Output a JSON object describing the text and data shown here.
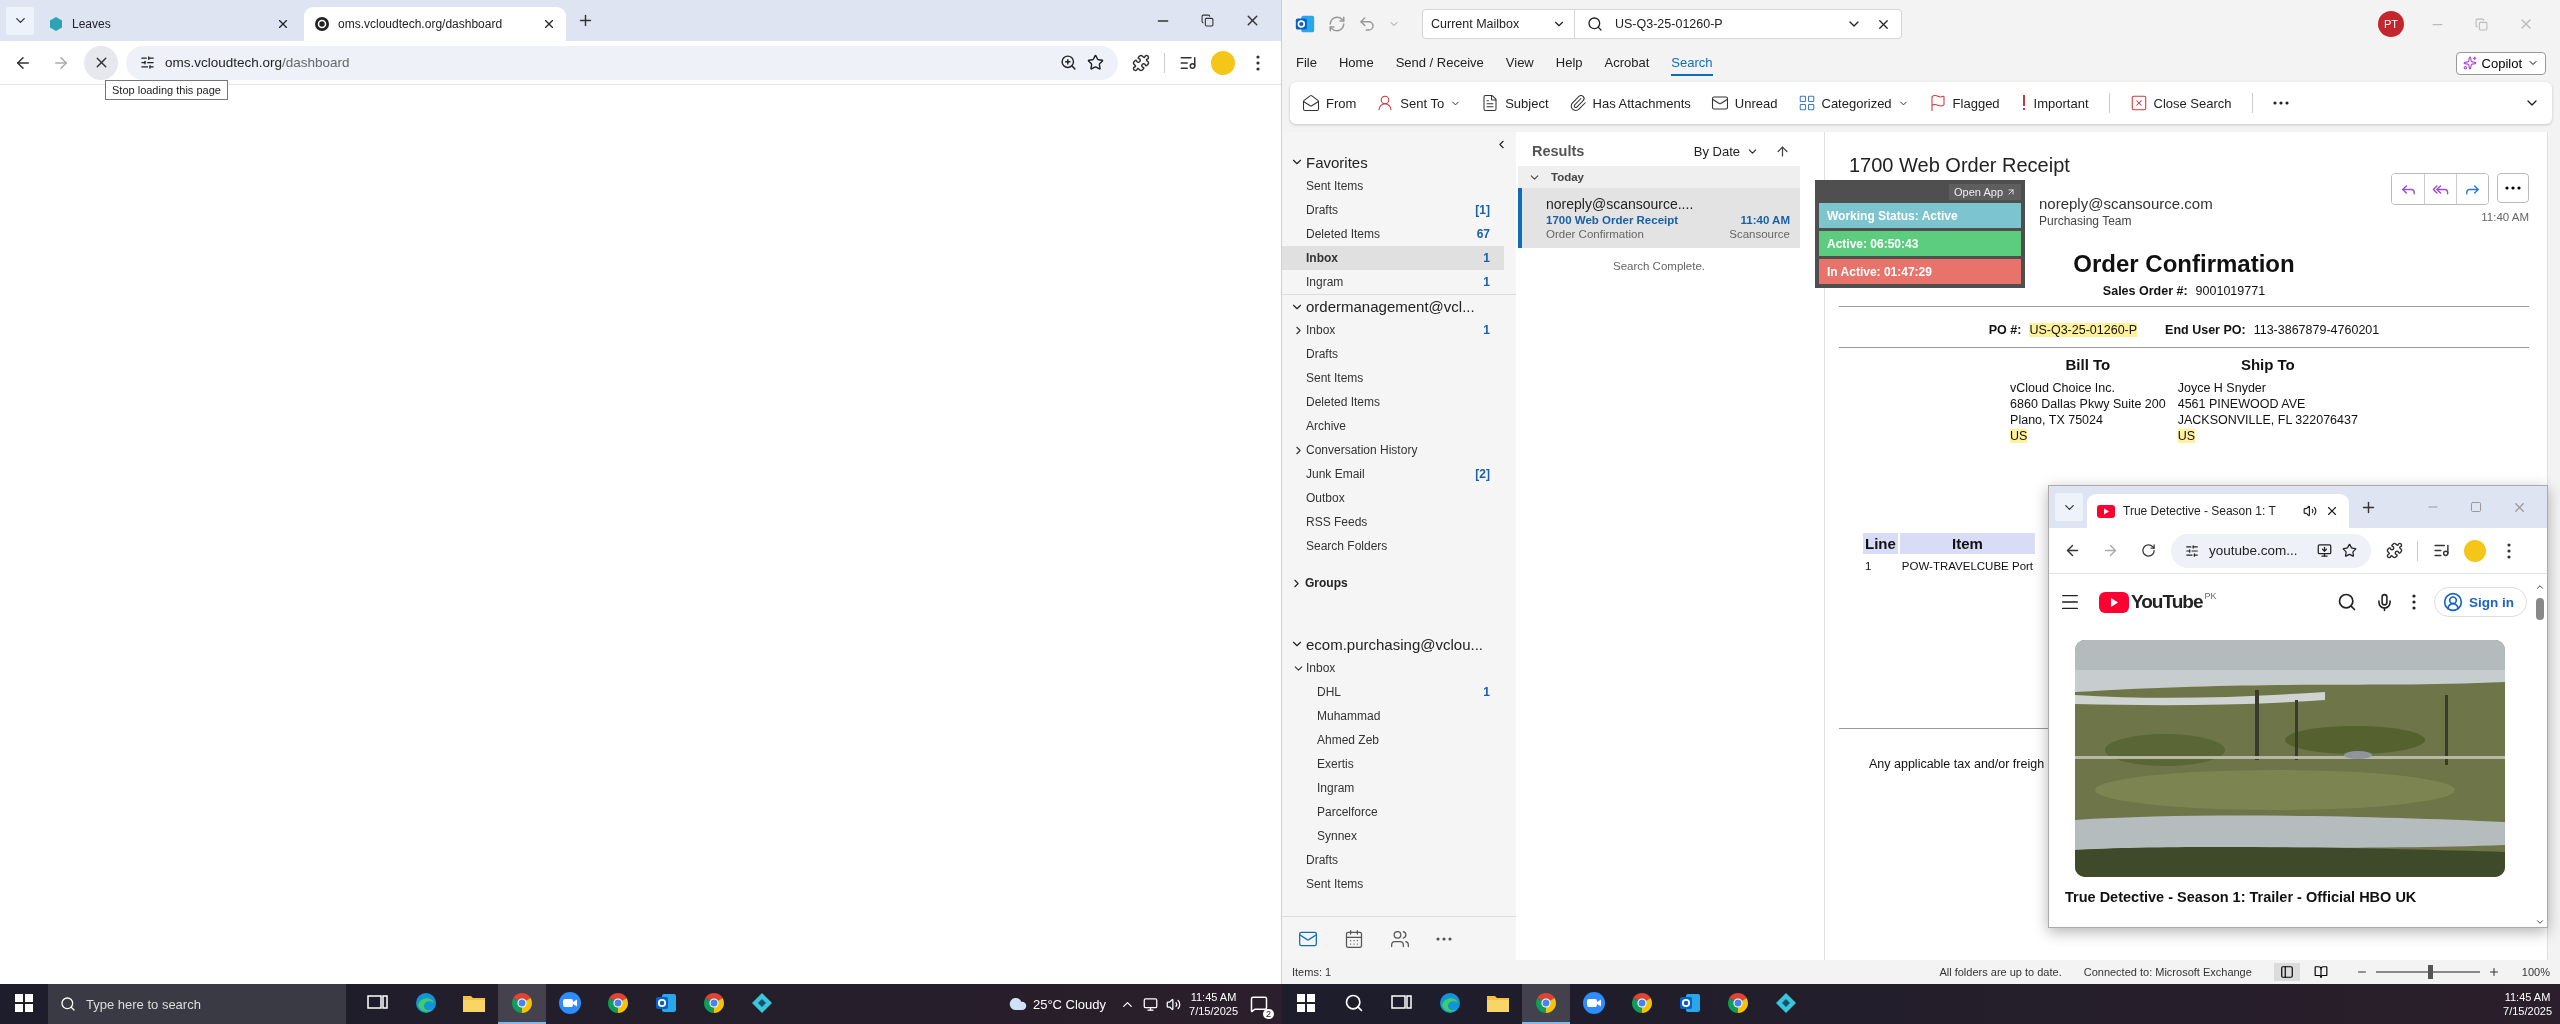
{
  "left_browser": {
    "tabs": [
      {
        "title": "Leaves",
        "selected": false
      },
      {
        "title": "oms.vcloudtech.org/dashboard",
        "selected": true
      }
    ],
    "loading": true,
    "address": {
      "host": "oms.vcloudtech.org",
      "path": "/dashboard"
    },
    "tooltip": "Stop loading this page"
  },
  "outlook": {
    "search": {
      "scope": "Current Mailbox",
      "query": "US-Q3-25-01260-P"
    },
    "account_initials": "PT",
    "menu": [
      {
        "label": "File",
        "selected": false
      },
      {
        "label": "Home",
        "selected": false
      },
      {
        "label": "Send / Receive",
        "selected": false
      },
      {
        "label": "View",
        "selected": false
      },
      {
        "label": "Help",
        "selected": false
      },
      {
        "label": "Acrobat",
        "selected": false
      },
      {
        "label": "Search",
        "selected": true
      }
    ],
    "copilot": "Copilot",
    "ribbon": [
      {
        "kind": "from",
        "label": "From",
        "dropdown": false
      },
      {
        "kind": "sent-to",
        "label": "Sent To",
        "dropdown": true
      },
      {
        "kind": "subject",
        "label": "Subject",
        "dropdown": false
      },
      {
        "kind": "attachments",
        "label": "Has Attachments",
        "dropdown": false
      },
      {
        "kind": "unread",
        "label": "Unread",
        "dropdown": false
      },
      {
        "kind": "categorized",
        "label": "Categorized",
        "dropdown": true
      },
      {
        "kind": "flagged",
        "label": "Flagged",
        "dropdown": false
      },
      {
        "kind": "important",
        "label": "Important",
        "dropdown": false
      },
      {
        "kind": "close",
        "label": "Close Search",
        "dropdown": false
      }
    ],
    "folder_groups": [
      {
        "kind": "heading",
        "title": "Favorites",
        "expanded": true,
        "folders": [
          {
            "name": "Sent Items",
            "selected": false
          },
          {
            "name": "Drafts",
            "count": "[1]",
            "selected": false
          },
          {
            "name": "Deleted Items",
            "count": "67",
            "selected": false
          },
          {
            "name": "Inbox",
            "count": "1",
            "selected": true
          },
          {
            "name": "Ingram",
            "count": "1",
            "selected": false
          }
        ]
      },
      {
        "kind": "heading",
        "title": "ordermanagement@vcl...",
        "expanded": true,
        "folders": [
          {
            "name": "Inbox",
            "count": "1",
            "expanded": false,
            "selected": false
          },
          {
            "name": "Drafts",
            "selected": false
          },
          {
            "name": "Sent Items",
            "selected": false
          },
          {
            "name": "Deleted Items",
            "selected": false
          },
          {
            "name": "Archive",
            "selected": false
          },
          {
            "name": "Conversation History",
            "expanded": false,
            "selected": false
          },
          {
            "name": "Junk Email",
            "count": "[2]",
            "selected": false
          },
          {
            "name": "Outbox",
            "selected": false
          },
          {
            "name": "RSS Feeds",
            "selected": false
          },
          {
            "name": "Search Folders",
            "selected": false
          }
        ]
      },
      {
        "kind": "section",
        "title": "Groups",
        "expanded": false
      },
      {
        "kind": "heading",
        "title": "ecom.purchasing@vclou...",
        "expanded": true,
        "folders": [
          {
            "name": "Inbox",
            "expanded": true,
            "selected": false,
            "children": [
              {
                "name": "DHL",
                "count": "1",
                "selected": false
              },
              {
                "name": "Muhammad",
                "selected": false
              },
              {
                "name": "Ahmed Zeb",
                "selected": false
              },
              {
                "name": "Exertis",
                "selected": false
              },
              {
                "name": "Ingram",
                "selected": false
              },
              {
                "name": "Parcelforce",
                "selected": false
              },
              {
                "name": "Synnex",
                "selected": false
              }
            ]
          },
          {
            "name": "Drafts",
            "selected": false
          },
          {
            "name": "Sent Items",
            "selected": false
          }
        ]
      }
    ],
    "nav": [
      {
        "kind": "mail",
        "selected": true
      },
      {
        "kind": "calendar",
        "selected": false
      },
      {
        "kind": "people",
        "selected": false
      },
      {
        "kind": "more",
        "selected": false
      }
    ],
    "results": {
      "title": "Results",
      "sort": "By Date",
      "group": "Today",
      "messages": [
        {
          "sender": "noreply@scansource....",
          "subject": "1700 Web Order Receipt",
          "time": "11:40 AM",
          "preview": "Order Confirmation",
          "tag": "Scansource",
          "selected": true
        }
      ],
      "status": "Search Complete."
    },
    "reading": {
      "subject": "1700 Web Order Receipt",
      "sender": "noreply@scansource.com",
      "to": "Purchasing Team",
      "time": "11:40 AM",
      "body": {
        "title": "Order Confirmation",
        "sales_order_label": "Sales Order #:",
        "sales_order": "9001019771",
        "order_fields": [
          {
            "label": "PO #:",
            "value": "US-Q3-25-01260-P",
            "highlighted": true
          },
          {
            "label": "End User PO:",
            "value": "113-3867879-4760201",
            "highlighted": false
          }
        ],
        "addresses": [
          {
            "title": "Bill To",
            "lines": [
              {
                "text": "vCloud Choice Inc.",
                "highlighted": false
              },
              {
                "text": "6860 Dallas Pkwy Suite 200",
                "highlighted": false
              },
              {
                "text": "Plano, TX 75024",
                "highlighted": false
              },
              {
                "text": "US",
                "highlighted": true
              }
            ]
          },
          {
            "title": "Ship To",
            "lines": [
              {
                "text": "Joyce H Snyder",
                "highlighted": false
              },
              {
                "text": "4561 PINEWOOD AVE",
                "highlighted": false
              },
              {
                "text": "JACKSONVILLE, FL 322076437",
                "highlighted": false
              },
              {
                "text": "US",
                "highlighted": true
              }
            ]
          }
        ],
        "table": {
          "columns": [
            "Line",
            "Item"
          ],
          "rows": [
            [
              "1",
              "POW-TRAVELCUBE Port"
            ]
          ]
        },
        "note": "Any applicable tax and/or freigh"
      }
    },
    "status_bar": {
      "items": "Items: 1",
      "sync": "All folders are up to date.",
      "connection": "Connected to: Microsoft Exchange",
      "zoom": "100%",
      "zoom_slider": {
        "level": 0.5
      }
    }
  },
  "activity_widget": {
    "link": "Open App",
    "rows": [
      {
        "label": "Working Status: Active",
        "color": "#7cc5cf"
      },
      {
        "label": "Active: 06:50:43",
        "color": "#5ccd7f"
      },
      {
        "label": "In Active: 01:47:29",
        "color": "#e8736a"
      }
    ]
  },
  "video_window": {
    "tab": "True Detective - Season 1: T",
    "audio": true,
    "address": "youtube.com...",
    "brand": "YouTube",
    "region": "PK",
    "sign_in": "Sign in",
    "video_title": "True Detective - Season 1: Trailer - Official HBO UK"
  },
  "left_taskbar": {
    "search_placeholder": "Type here to search",
    "apps": [
      {
        "kind": "taskview",
        "active": false
      },
      {
        "kind": "edge",
        "active": false
      },
      {
        "kind": "folder",
        "active": false
      },
      {
        "kind": "chrome",
        "active": true
      },
      {
        "kind": "zoom",
        "active": false
      },
      {
        "kind": "chrome",
        "active": false
      },
      {
        "kind": "outlook",
        "active": false
      },
      {
        "kind": "chrome",
        "active": false
      },
      {
        "kind": "app",
        "active": false
      }
    ],
    "weather": "25°C  Cloudy",
    "time": "11:45 AM",
    "date": "7/15/2025",
    "notifications": "2"
  },
  "right_taskbar": {
    "apps": [
      {
        "kind": "search",
        "active": false
      },
      {
        "kind": "taskview",
        "active": false
      },
      {
        "kind": "edge",
        "active": false
      },
      {
        "kind": "folder",
        "active": false
      },
      {
        "kind": "chrome",
        "active": true
      },
      {
        "kind": "zoom",
        "active": false
      },
      {
        "kind": "chrome",
        "active": false
      },
      {
        "kind": "outlook",
        "active": false
      },
      {
        "kind": "chrome",
        "active": false
      },
      {
        "kind": "app",
        "active": false
      }
    ],
    "time": "11:45 AM",
    "date": "7/15/2025"
  }
}
